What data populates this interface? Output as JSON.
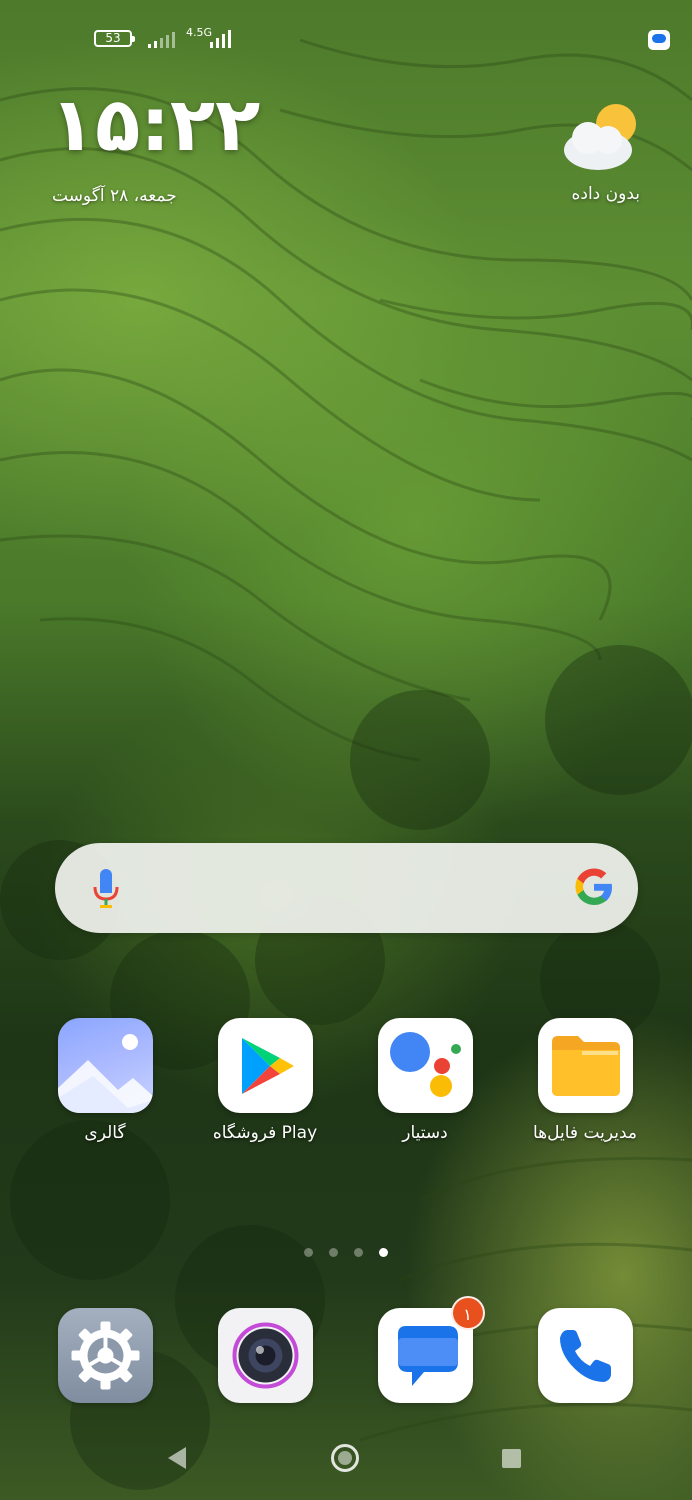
{
  "status_bar": {
    "battery_level": "53",
    "network_label": "4.5G",
    "notification_icon": "messages-notification-icon"
  },
  "clock_widget": {
    "time": "۱۵:۲۲",
    "date": "جمعه، ۲۸ آگوست"
  },
  "weather_widget": {
    "icon": "partly-cloudy-icon",
    "text": "بدون داده"
  },
  "search_bar": {
    "mic_icon": "google-mic-icon",
    "logo_icon": "google-g-icon"
  },
  "apps": [
    {
      "label": "گالری",
      "icon": "gallery-icon"
    },
    {
      "label": "فروشگاه Play",
      "icon": "play-store-icon"
    },
    {
      "label": "دستیار",
      "icon": "assistant-icon"
    },
    {
      "label": "مدیریت فایل‌ها",
      "icon": "file-manager-icon"
    }
  ],
  "page_indicator": {
    "pages": 4,
    "active": 4
  },
  "dock": [
    {
      "icon": "settings-icon"
    },
    {
      "icon": "camera-icon"
    },
    {
      "icon": "messages-icon",
      "badge": "۱"
    },
    {
      "icon": "phone-icon"
    }
  ],
  "navigation": [
    "back-icon",
    "home-icon",
    "recents-icon"
  ],
  "colors": {
    "badge": "#e8501e",
    "messages_blue": "#1a73e8",
    "folder_yellow": "#ffc02a"
  }
}
